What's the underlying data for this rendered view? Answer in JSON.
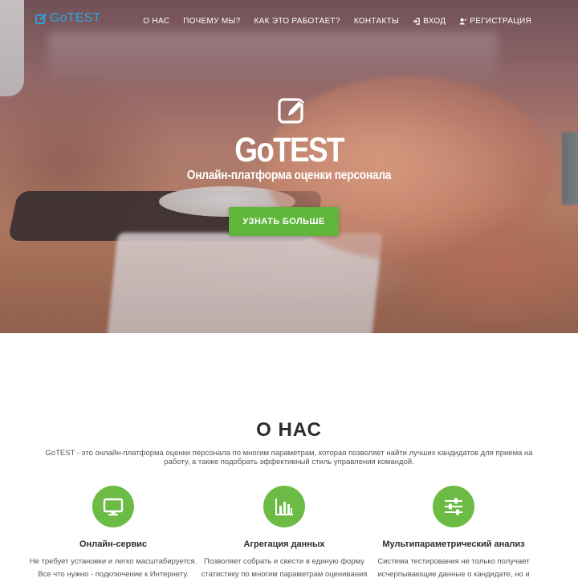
{
  "nav": {
    "logo_text": "GoTEST",
    "items": [
      {
        "label": "О НАС"
      },
      {
        "label": "ПОЧЕМУ МЫ?"
      },
      {
        "label": "КАК ЭТО РАБОТАЕТ?"
      },
      {
        "label": "КОНТАКТЫ"
      },
      {
        "label": "ВХОД",
        "icon": "sign-in-icon"
      },
      {
        "label": "РЕГИСТРАЦИЯ",
        "icon": "user-plus-icon"
      }
    ]
  },
  "hero": {
    "icon": "edit-icon",
    "title": "GoTEST",
    "subtitle": "Онлайн-платформа оценки персонала",
    "cta_label": "УЗНАТЬ БОЛЬШЕ"
  },
  "about": {
    "title": "О НАС",
    "text": "GoTEST - это онлайн-платформа оценки персонала по многим параметрам, которая позволяет найти лучших кандидатов для приема на работу, а также подобрать эффективный стиль управления командой.",
    "features": [
      {
        "icon": "monitor-icon",
        "title": "Онлайн-сервис",
        "lines": [
          "Не требует установки и легко масштабируется.",
          "Все что нужно - подключение к Интернету."
        ]
      },
      {
        "icon": "bar-chart-icon",
        "title": "Агрегация данных",
        "lines": [
          "Позволяет собрать и свести в единую форму",
          "статистику по многим параметрам оценивания"
        ]
      },
      {
        "icon": "sliders-icon",
        "title": "Мультипараметрический анализ",
        "lines": [
          "Система тестирования не только получает",
          "исчерпывающие данные о кандидате, но и"
        ]
      }
    ]
  },
  "colors": {
    "brand_blue": "#2aa7df",
    "accent_green": "#5fb63b",
    "icon_green": "#6cbb45"
  }
}
